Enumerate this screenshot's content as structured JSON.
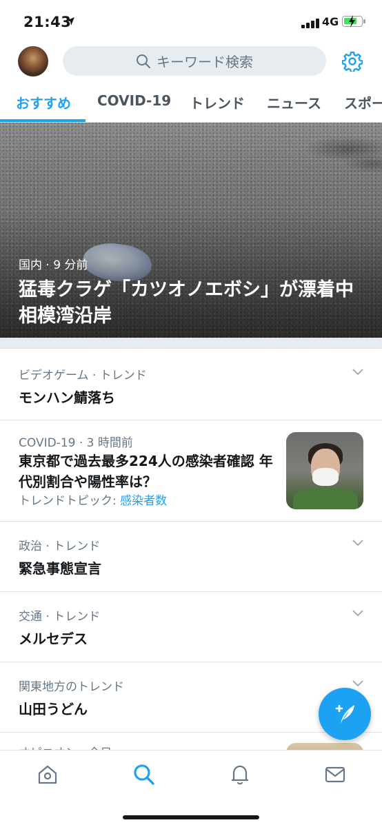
{
  "status_bar": {
    "time": "21:43",
    "network": "4G"
  },
  "header": {
    "search_placeholder": "キーワード検索",
    "icons": [
      "avatar",
      "search-icon",
      "gear-icon"
    ]
  },
  "tabs": [
    {
      "label": "おすすめ",
      "active": true
    },
    {
      "label": "COVID-19",
      "active": false
    },
    {
      "label": "トレンド",
      "active": false
    },
    {
      "label": "ニュース",
      "active": false
    },
    {
      "label": "スポー",
      "active": false
    }
  ],
  "hero": {
    "meta": "国内 · 9 分前",
    "title": "猛毒クラゲ「カツオノエボシ」が漂着中 相模湾沿岸"
  },
  "trends": [
    {
      "meta": "ビデオゲーム · トレンド",
      "title": "モンハン鯖落ち"
    },
    {
      "meta": "政治 · トレンド",
      "title": "緊急事態宣言"
    },
    {
      "meta": "交通 · トレンド",
      "title": "メルセデス"
    },
    {
      "meta": "関東地方のトレンド",
      "title": "山田うどん"
    }
  ],
  "news_item": {
    "meta": "COVID-19 · 3 時間前",
    "title": "東京都で過去最多224人の感染者確認 年代別割合や陽性率は？",
    "topic_prefix": "トレンドトピック: ",
    "topic_link": "感染者数"
  },
  "partial_item": {
    "meta": "オピニオン · 今日"
  },
  "bottom_nav": [
    "home-icon",
    "search-icon",
    "notifications-icon",
    "messages-icon"
  ],
  "colors": {
    "accent": "#1da1f2",
    "secondary_text": "#657786",
    "divider": "#e6ecf0"
  }
}
